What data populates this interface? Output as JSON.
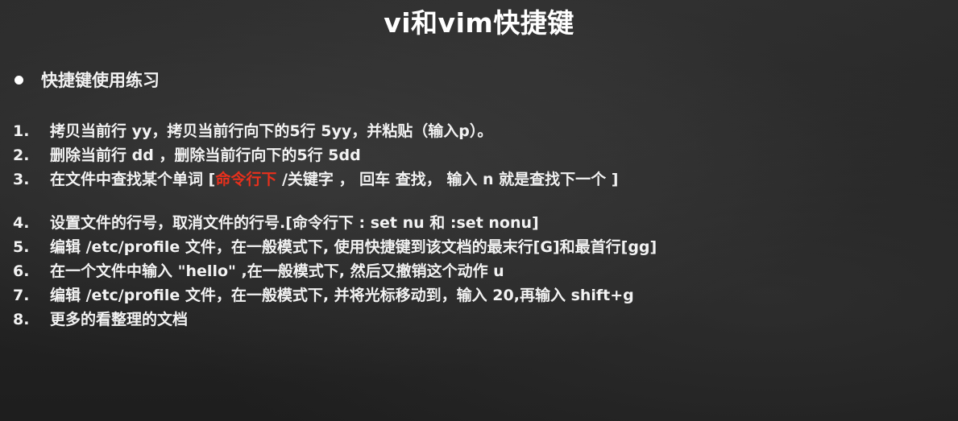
{
  "slide": {
    "title": "vi和vim快捷键",
    "heading": "快捷键使用练习",
    "items": [
      {
        "num": "1.",
        "text": "拷贝当前行   yy，拷贝当前行向下的5行  5yy，并粘贴（输入p）。"
      },
      {
        "num": "2.",
        "text": "删除当前行  dd ，删除当前行向下的5行 5dd"
      },
      {
        "num": "3.",
        "pre": "在文件中查找某个单词 [",
        "highlight": "命令行下",
        "post": " /关键字  ，  回车 查找， 输入 n 就是查找下一个 ]"
      },
      {
        "num": "4.",
        "text": "设置文件的行号，取消文件的行号.[命令行下  : set nu 和  :set nonu]"
      },
      {
        "num": "5.",
        "text": "编辑 /etc/profile 文件，在一般模式下, 使用快捷键到该文档的最末行[G]和最首行[gg]"
      },
      {
        "num": "6.",
        "text": "在一个文件中输入 \"hello\" ,在一般模式下, 然后又撤销这个动作  u"
      },
      {
        "num": "7.",
        "text": "编辑  /etc/profile 文件，在一般模式下,  并将光标移动到，输入 20,再输入 shift+g"
      },
      {
        "num": "8.",
        "text": "更多的看整理的文档"
      }
    ],
    "highlight_color": "#e8301c"
  }
}
